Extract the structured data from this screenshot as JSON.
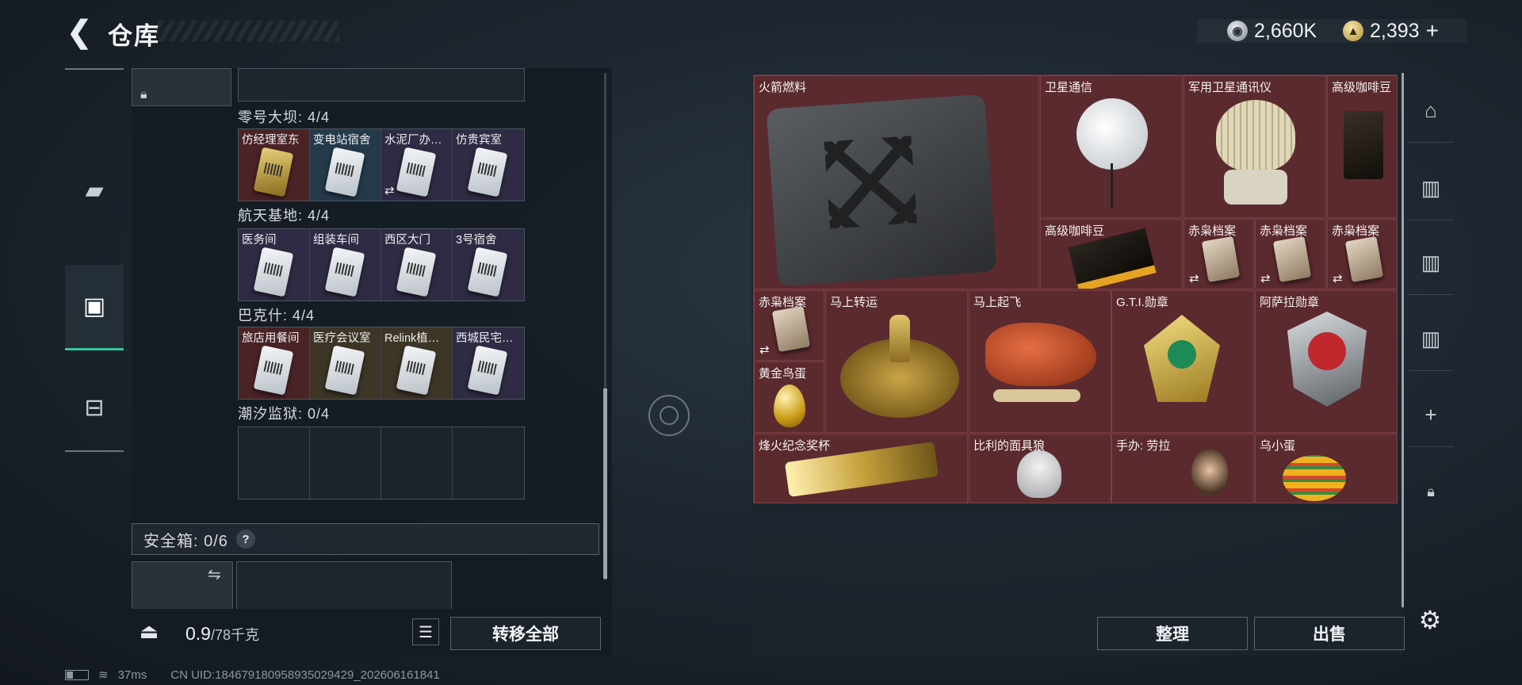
{
  "header": {
    "title": "仓库",
    "currency_silver": "2,660K",
    "currency_gold": "2,393",
    "gold_add": "+"
  },
  "left_rail": {
    "items": [
      {
        "icon": "gun-icon",
        "glyph": "⌐"
      },
      {
        "icon": "vest-icon",
        "glyph": "⛨"
      },
      {
        "icon": "backpack-icon",
        "glyph": "▣"
      },
      {
        "icon": "briefcase-icon",
        "glyph": "⊟"
      }
    ]
  },
  "container": {
    "sections": [
      {
        "name": "零号大坝: 4/4",
        "cells": [
          "仿经理室东",
          "变电站宿舍",
          "水泥厂办…",
          "仿贵宾室"
        ]
      },
      {
        "name": "航天基地: 4/4",
        "cells": [
          "医务间",
          "组装车间",
          "西区大门",
          "3号宿舍"
        ]
      },
      {
        "name": "巴克什: 4/4",
        "cells": [
          "旅店用餐间",
          "医疗会议室",
          "Relink植…",
          "西城民宅…"
        ]
      },
      {
        "name": "潮汐监狱: 0/4",
        "cells": []
      }
    ],
    "safe_box": "安全箱: 0/6",
    "help": "?",
    "weight_current": "0.9",
    "weight_max": "/78千克",
    "transfer_all": "转移全部"
  },
  "stash": {
    "items": [
      {
        "label": "火箭燃料"
      },
      {
        "label": "卫星通信"
      },
      {
        "label": "军用卫星通讯仪"
      },
      {
        "label": "高级咖啡豆"
      },
      {
        "label": "高级咖啡豆"
      },
      {
        "label": "赤枭档案"
      },
      {
        "label": "赤枭档案"
      },
      {
        "label": "赤枭档案"
      },
      {
        "label": "赤枭档案"
      },
      {
        "label": "马上转运"
      },
      {
        "label": "马上起飞"
      },
      {
        "label": "G.T.I.勋章"
      },
      {
        "label": "阿萨拉勋章"
      },
      {
        "label": "黄金鸟蛋"
      },
      {
        "label": "烽火纪念奖杯"
      },
      {
        "label": "比利的面具狼"
      },
      {
        "label": "手办: 劳拉"
      },
      {
        "label": "乌小蛋"
      }
    ],
    "organize": "整理",
    "sell": "出售"
  },
  "status": {
    "ping": "37ms",
    "uid": "CN UID:18467918095893502942​9_202606161841"
  },
  "colors": {
    "accent": "#35c4a0",
    "rare_red": "#5b2a2f"
  }
}
